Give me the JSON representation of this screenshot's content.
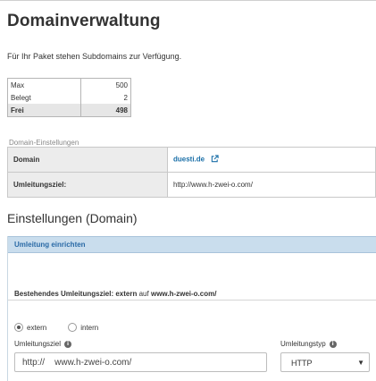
{
  "page": {
    "title": "Domainverwaltung",
    "intro": "Für Ihr Paket stehen Subdomains zur Verfügung."
  },
  "quota": [
    {
      "label": "Max",
      "value": "500"
    },
    {
      "label": "Belegt",
      "value": "2"
    },
    {
      "label": "Frei",
      "value": "498"
    }
  ],
  "domain_settings": {
    "legend": "Domain-Einstellungen",
    "domain_label": "Domain",
    "domain_value": "duesti.de",
    "redirect_label": "Umleitungsziel:",
    "redirect_value": "http://www.h-zwei-o.com/",
    "icon": "external-link-icon"
  },
  "settings": {
    "title": "Einstellungen (Domain)",
    "panel_title": "Umleitung einrichten",
    "current_prefix": "Bestehendes Umleitungsziel: extern",
    "current_auf": "auf",
    "current_target": "www.h-zwei-o.com/",
    "radio_extern": "extern",
    "radio_intern": "intern",
    "selected_radio": "extern",
    "target_label": "Umleitungsziel",
    "target_value": "http://    www.h-zwei-o.com/",
    "type_label": "Umleitungstyp",
    "type_value": "HTTP"
  },
  "colors": {
    "link": "#1a6fa8",
    "panel_header_bg": "#c9dded",
    "panel_header_text": "#2a6aa6"
  }
}
